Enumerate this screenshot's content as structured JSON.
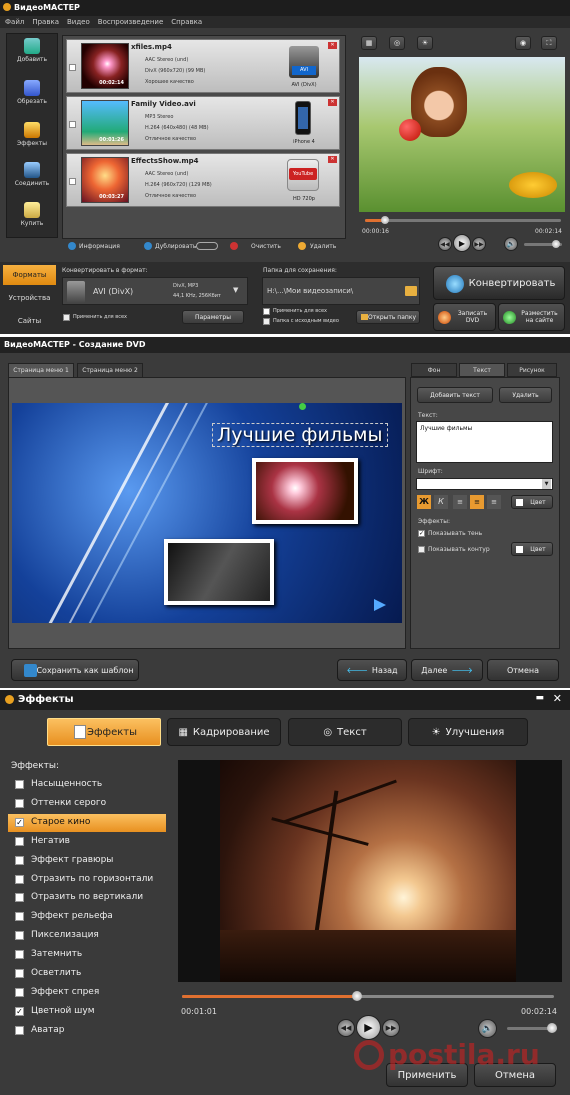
{
  "w1": {
    "title": "ВидеоМАСТЕР",
    "menu": [
      "Файл",
      "Правка",
      "Видео",
      "Воспроизведение",
      "Справка"
    ],
    "sidebar": [
      "Добавить",
      "Обрезать",
      "Эффекты",
      "Соединить",
      "Купить"
    ],
    "files": [
      {
        "name": "xfiles.mp4",
        "a": "AAC Stereo (und)",
        "v": "DivX (960x720) (99 MB)",
        "q": "Хорошее качество",
        "dur": "00:02:14",
        "fmt": "AVI (DivX)",
        "badge": "AVI"
      },
      {
        "name": "Family Video.avi",
        "a": "MP3 Stereo",
        "v": "H.264 (640x480) (48 MB)",
        "q": "Отличное качество",
        "dur": "00:01:26",
        "fmt": "iPhone 4",
        "badge": ""
      },
      {
        "name": "EffectsShow.mp4",
        "a": "AAC Stereo (und)",
        "v": "H.264 (960x720) (129 MB)",
        "q": "Отличное качество",
        "dur": "00:03:27",
        "fmt": "HD 720p",
        "badge": "YouTube"
      }
    ],
    "bottombar": {
      "info": "Информация",
      "dup": "Дублировать",
      "clear": "Очистить",
      "del": "Удалить"
    },
    "preview": {
      "t_cur": "00:00:16",
      "t_end": "00:02:14",
      "progress": 0.1,
      "volume": 0.85
    },
    "tabs": [
      "Форматы",
      "Устройства",
      "Сайты"
    ],
    "convert": {
      "label": "Конвертировать в формат:",
      "fmt": "AVI (DivX)",
      "codec": "DivX, MP3",
      "params": "44,1 KHz, 256Кбит",
      "apply": "Применить для всех",
      "params_btn": "Параметры"
    },
    "save": {
      "label": "Папка для сохранения:",
      "path": "H:\\...\\Мои видеозаписи\\",
      "apply": "Применить для всех",
      "src": "Папка с исходным видео",
      "open": "Открыть папку"
    },
    "actions": {
      "convert": "Конвертировать",
      "dvd": "Записать DVD",
      "site": "Разместить на сайте"
    }
  },
  "w2": {
    "title": "ВидеоМАСТЕР - Создание DVD",
    "pages": [
      "Страница меню 1",
      "Страница меню 2"
    ],
    "tabs": [
      "Фон",
      "Текст",
      "Рисунок"
    ],
    "add": "Добавить текст",
    "del": "Удалить",
    "text_label": "Текст:",
    "text_value": "Лучшие фильмы",
    "font_label": "Шрифт:",
    "color": "Цвет",
    "effects_label": "Эффекты:",
    "shadow": "Показывать тень",
    "outline": "Показывать контур",
    "canvas_title": "Лучшие фильмы",
    "save_tpl": "Сохранить как шаблон",
    "back": "Назад",
    "next": "Далее",
    "cancel": "Отмена"
  },
  "w3": {
    "title": "Эффекты",
    "tabs": [
      "Эффекты",
      "Кадрирование",
      "Текст",
      "Улучшения"
    ],
    "effects_label": "Эффекты:",
    "effects": [
      {
        "label": "Насыщенность",
        "checked": false
      },
      {
        "label": "Оттенки серого",
        "checked": false
      },
      {
        "label": "Старое кино",
        "checked": true
      },
      {
        "label": "Негатив",
        "checked": false
      },
      {
        "label": "Эффект гравюры",
        "checked": false
      },
      {
        "label": "Отразить по горизонтали",
        "checked": false
      },
      {
        "label": "Отразить по вертикали",
        "checked": false
      },
      {
        "label": "Эффект рельефа",
        "checked": false
      },
      {
        "label": "Пикселизация",
        "checked": false
      },
      {
        "label": "Затемнить",
        "checked": false
      },
      {
        "label": "Осветлить",
        "checked": false
      },
      {
        "label": "Эффект спрея",
        "checked": false
      },
      {
        "label": "Цветной шум",
        "checked": true
      },
      {
        "label": "Аватар",
        "checked": false
      }
    ],
    "t_cur": "00:01:01",
    "t_end": "00:02:14",
    "progress": 0.47,
    "volume": 0.9,
    "apply": "Применить",
    "cancel": "Отмена"
  },
  "watermark": "postila.ru"
}
